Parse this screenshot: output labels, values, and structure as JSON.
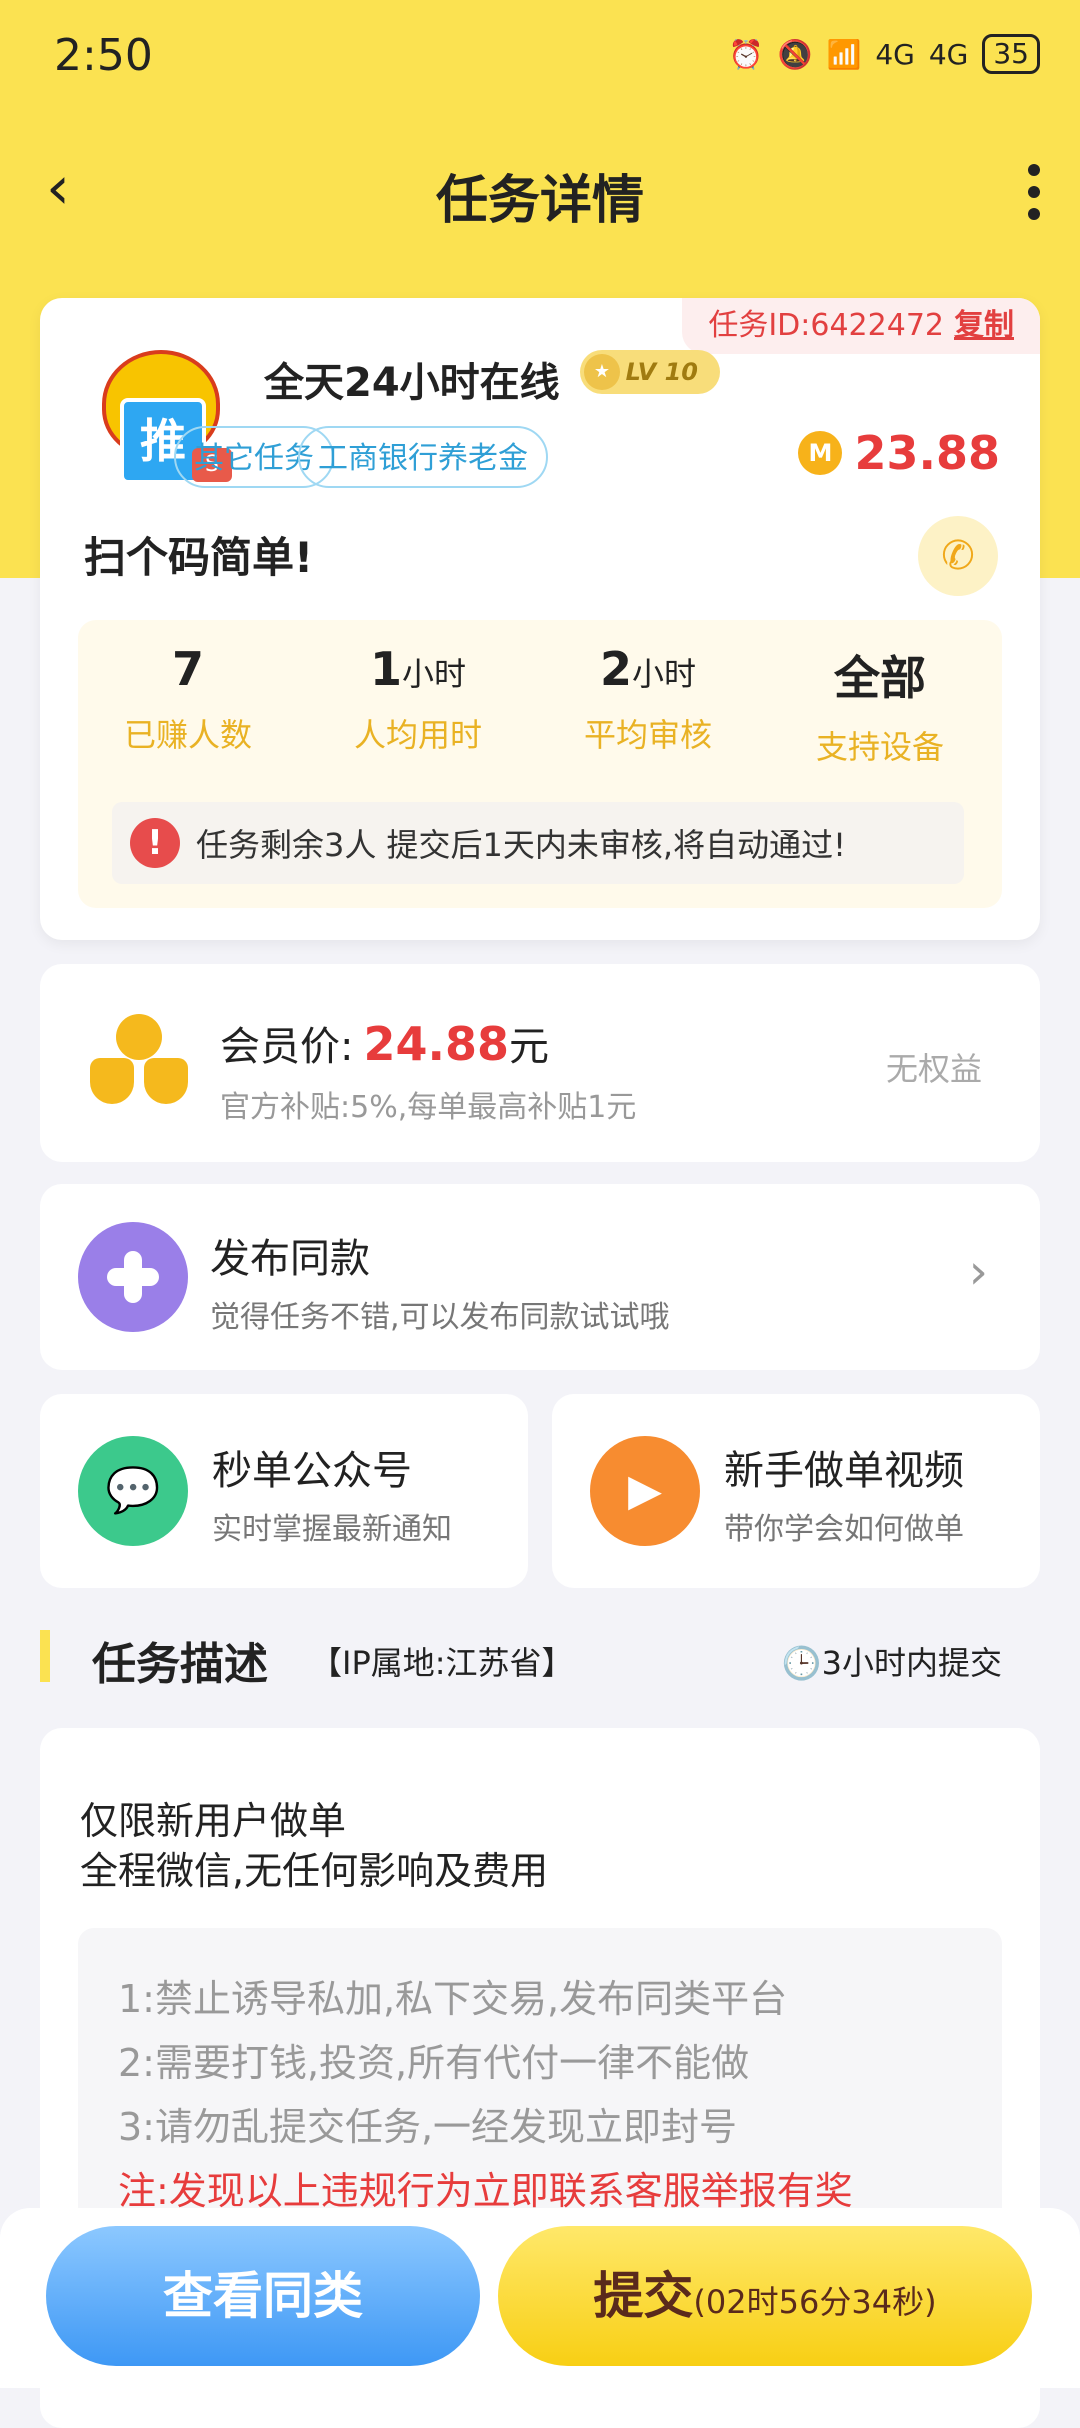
{
  "status_bar": {
    "time": "2:50",
    "network1": "4G",
    "network2": "4G",
    "battery": "35"
  },
  "nav": {
    "title": "任务详情"
  },
  "task": {
    "id_label": "任务ID:6422472",
    "copy_label": "复制",
    "name": "全天24小时在线",
    "level": "LV 10",
    "tags": [
      "其它任务",
      "工商银行养老金"
    ],
    "reward": "23.88",
    "coin_symbol": "M",
    "slogan": "扫个码简单!",
    "mascot_text": "推",
    "mascot_badge": "S"
  },
  "stats": [
    {
      "value": "7",
      "unit": "",
      "label": "已赚人数"
    },
    {
      "value": "1",
      "unit": "小时",
      "label": "人均用时"
    },
    {
      "value": "2",
      "unit": "小时",
      "label": "平均审核"
    },
    {
      "value": "全部",
      "unit": "",
      "label": "支持设备"
    }
  ],
  "notice": {
    "icon": "!",
    "text": "任务剩余3人  提交后1天内未审核,将自动通过!"
  },
  "vip": {
    "label": "会员价:",
    "price": "24.88",
    "unit": "元",
    "subsidy": "官方补贴:5%,每单最高补贴1元",
    "right_text": "无权益"
  },
  "publish": {
    "title": "发布同款",
    "subtitle": "觉得任务不错,可以发布同款试试哦"
  },
  "wechat": {
    "title": "秒单公众号",
    "subtitle": "实时掌握最新通知"
  },
  "video": {
    "title": "新手做单视频",
    "subtitle": "带你学会如何做单"
  },
  "description": {
    "title": "任务描述",
    "ip": "【IP属地:江苏省】",
    "deadline": "3小时内提交",
    "line1": "仅限新用户做单",
    "line2": "全程微信,无任何影响及费用",
    "rules": [
      "1:禁止诱导私加,私下交易,发布同类平台",
      "2:需要打钱,投资,所有代付一律不能做",
      "3:请勿乱提交任务,一经发现立即封号"
    ],
    "note": "注:发现以上违规行为立即联系客服举报有奖"
  },
  "bottom": {
    "view_similar": "查看同类",
    "submit": "提交",
    "countdown": "(02时56分34秒)"
  },
  "colors": {
    "header": "#fbe251",
    "accent_red": "#e73c3c",
    "label_gold": "#e9b224",
    "tag_blue": "#2f9fd6"
  }
}
